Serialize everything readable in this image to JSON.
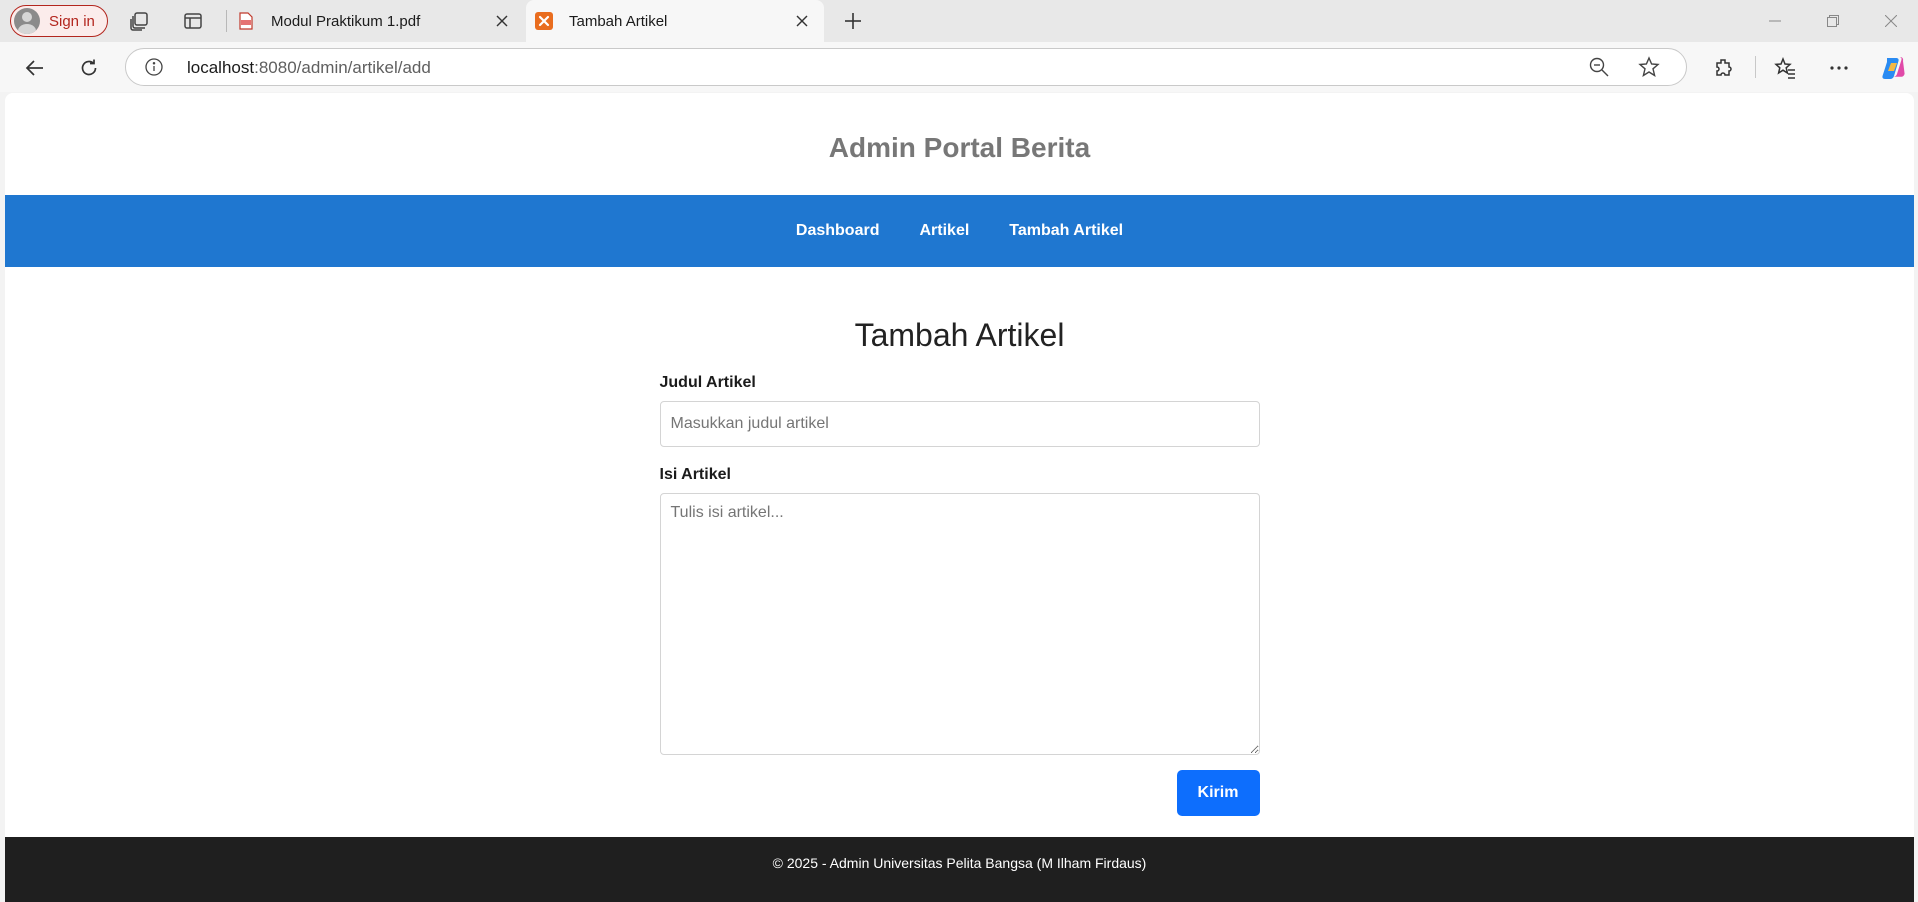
{
  "browser": {
    "signin_label": "Sign in",
    "tabs": [
      {
        "title": "Modul Praktikum 1.pdf"
      },
      {
        "title": "Tambah Artikel"
      }
    ],
    "url_host": "localhost",
    "url_path": ":8080/admin/artikel/add"
  },
  "site": {
    "title": "Admin Portal Berita",
    "nav": [
      {
        "label": "Dashboard"
      },
      {
        "label": "Artikel"
      },
      {
        "label": "Tambah Artikel"
      }
    ]
  },
  "form": {
    "heading": "Tambah Artikel",
    "title_label": "Judul Artikel",
    "title_placeholder": "Masukkan judul artikel",
    "body_label": "Isi Artikel",
    "body_placeholder": "Tulis isi artikel...",
    "submit_label": "Kirim"
  },
  "footer": {
    "text": "© 2025 - Admin Universitas Pelita Bangsa (M Ilham Firdaus)"
  },
  "colors": {
    "nav_bg": "#1f77d0",
    "submit_bg": "#0d6efd",
    "footer_bg": "#1f1f1f",
    "title_text": "#777777",
    "signin_accent": "#b3261e"
  }
}
